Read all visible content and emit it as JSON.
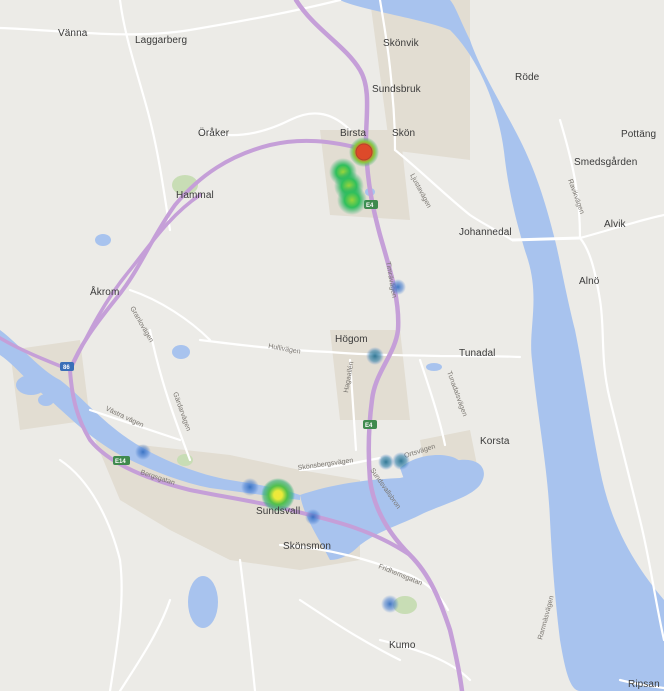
{
  "map": {
    "colors": {
      "land": "#ecebe7",
      "water": "#a8c3ee",
      "motorway": "#c59fd8",
      "road": "#ffffff",
      "urban": "#e2ddd2",
      "park": "#c8ddb5",
      "shield": "#3f8a4e"
    },
    "places": [
      {
        "id": "vanna",
        "name": "Vänna"
      },
      {
        "id": "laggarberg",
        "name": "Laggarberg"
      },
      {
        "id": "skonvik",
        "name": "Skönvik"
      },
      {
        "id": "sundsbruk",
        "name": "Sundsbruk"
      },
      {
        "id": "rode",
        "name": "Röde"
      },
      {
        "id": "oraker",
        "name": "Öråker"
      },
      {
        "id": "birsta",
        "name": "Birsta"
      },
      {
        "id": "skon",
        "name": "Skön"
      },
      {
        "id": "pottang",
        "name": "Pottäng"
      },
      {
        "id": "smedsgarden",
        "name": "Smedsgården"
      },
      {
        "id": "hammal",
        "name": "Hammal"
      },
      {
        "id": "johannedal",
        "name": "Johannedal"
      },
      {
        "id": "alvik",
        "name": "Alvik"
      },
      {
        "id": "alno",
        "name": "Alnö"
      },
      {
        "id": "akrom",
        "name": "Åkrom"
      },
      {
        "id": "hogom",
        "name": "Högom"
      },
      {
        "id": "tunadal",
        "name": "Tunadal"
      },
      {
        "id": "korsta",
        "name": "Korsta"
      },
      {
        "id": "sundsvall",
        "name": "Sundsvall"
      },
      {
        "id": "skonsmon",
        "name": "Skönsmon"
      },
      {
        "id": "kumo",
        "name": "Kumo"
      },
      {
        "id": "ripsand",
        "name": "Ripsan"
      }
    ],
    "roads": [
      {
        "id": "ljustavagen",
        "name": "Ljustavägen"
      },
      {
        "id": "hullivagen",
        "name": "Hullivägen"
      },
      {
        "id": "vastra-vagen",
        "name": "Västra vägen"
      },
      {
        "id": "bergsgatan",
        "name": "Bergsgatan"
      },
      {
        "id": "skonsbergsvagen",
        "name": "Skönsbergsvägen"
      },
      {
        "id": "sundsvallsbron",
        "name": "Sundsvallsbron"
      },
      {
        "id": "fridhemsgatan",
        "name": "Fridhemsgatan"
      },
      {
        "id": "ortsvagen",
        "name": "Ortsvägen"
      },
      {
        "id": "timravagen",
        "name": "Timrävägen"
      },
      {
        "id": "tunadalsvagen",
        "name": "Tunadalsvägen"
      },
      {
        "id": "gardarvagen",
        "name": "Gärdarvägen"
      },
      {
        "id": "hagaallen",
        "name": "Hagaallén"
      },
      {
        "id": "granlovagen",
        "name": "Granlovägen"
      },
      {
        "id": "ramnasvagen",
        "name": "Ramnäsvägen"
      },
      {
        "id": "ravikvagen",
        "name": "Ravikvägen"
      }
    ],
    "shields": [
      {
        "id": "e4-north",
        "label": "E4"
      },
      {
        "id": "e4-mid",
        "label": "E4"
      },
      {
        "id": "e14-west",
        "label": "E14"
      },
      {
        "id": "road86",
        "label": "86"
      }
    ],
    "heatmap": {
      "scale_colors": [
        "#4a7fd0",
        "#2fae6e",
        "#8cc63e",
        "#f3e63a",
        "#e0452a"
      ],
      "hotspots": [
        {
          "id": "birsta-top",
          "intensity": 1.0
        },
        {
          "id": "birsta-mall-1",
          "intensity": 0.65
        },
        {
          "id": "birsta-mall-2",
          "intensity": 0.6
        },
        {
          "id": "birsta-mall-3",
          "intensity": 0.55
        },
        {
          "id": "sundsvall-center",
          "intensity": 0.9
        },
        {
          "id": "hogom",
          "intensity": 0.35
        },
        {
          "id": "ortsvagen-1",
          "intensity": 0.3
        },
        {
          "id": "ortsvagen-2",
          "intensity": 0.3
        },
        {
          "id": "sundsvall-west",
          "intensity": 0.2
        },
        {
          "id": "skonsmon",
          "intensity": 0.2
        },
        {
          "id": "kumo",
          "intensity": 0.25
        },
        {
          "id": "ne-road",
          "intensity": 0.2
        }
      ]
    }
  }
}
